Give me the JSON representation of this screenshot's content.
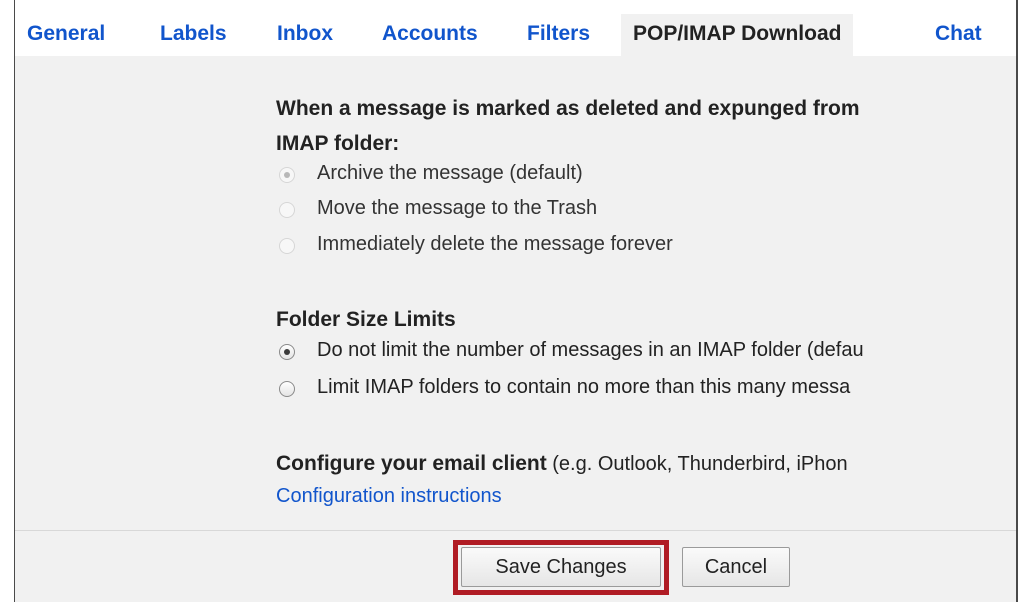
{
  "tabs": [
    {
      "label": "General",
      "active": false
    },
    {
      "label": "Labels",
      "active": false
    },
    {
      "label": "Inbox",
      "active": false
    },
    {
      "label": "Accounts",
      "active": false
    },
    {
      "label": "Filters",
      "active": false
    },
    {
      "label": "POP/IMAP Download",
      "active": true
    },
    {
      "label": "Chat",
      "active": false
    }
  ],
  "expunge_section": {
    "heading_line1": "When a message is marked as deleted and expunged from",
    "heading_line2": "IMAP folder:",
    "options": [
      {
        "label": "Archive the message (default)",
        "selected": true,
        "disabled": true
      },
      {
        "label": "Move the message to the Trash",
        "selected": false,
        "disabled": true
      },
      {
        "label": "Immediately delete the message forever",
        "selected": false,
        "disabled": true
      }
    ]
  },
  "folder_size_section": {
    "heading": "Folder Size Limits",
    "options": [
      {
        "label": "Do not limit the number of messages in an IMAP folder (defau",
        "selected": true,
        "disabled": false
      },
      {
        "label": "Limit IMAP folders to contain no more than this many messa",
        "selected": false,
        "disabled": false
      }
    ]
  },
  "configure_section": {
    "heading_bold": "Configure your email client",
    "heading_rest": " (e.g. Outlook, Thunderbird, iPhon",
    "link": "Configuration instructions"
  },
  "buttons": {
    "save": "Save Changes",
    "cancel": "Cancel"
  },
  "colors": {
    "link": "#1155cc",
    "highlight_border": "#b01c24",
    "panel_background": "#f1f1f1"
  }
}
